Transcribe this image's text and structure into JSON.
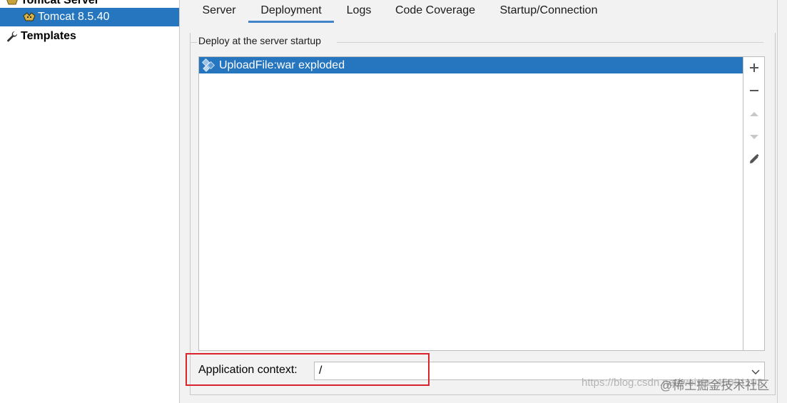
{
  "tree": {
    "parent_label": "Tomcat Server",
    "selected_label": "Tomcat 8.5.40",
    "templates_label": "Templates"
  },
  "tabs": [
    {
      "label": "Server"
    },
    {
      "label": "Deployment"
    },
    {
      "label": "Logs"
    },
    {
      "label": "Code Coverage"
    },
    {
      "label": "Startup/Connection"
    }
  ],
  "active_tab": "Deployment",
  "deploy": {
    "group_title": "Deploy at the server startup",
    "items": [
      {
        "label": "UploadFile:war exploded",
        "icon": "artifact-icon"
      }
    ],
    "toolbar": [
      "add-icon",
      "remove-icon",
      "move-up-icon",
      "move-down-icon",
      "edit-icon"
    ]
  },
  "context": {
    "label": "Application context:",
    "value": "/"
  },
  "watermark": {
    "url_text": "https://blog.csdn.net/weixin_45051193",
    "site_text": "@稀土掘金技术社区"
  },
  "colors": {
    "selection": "#2675bf",
    "tab_underline": "#4083c9",
    "highlight_box": "#d9232d"
  }
}
